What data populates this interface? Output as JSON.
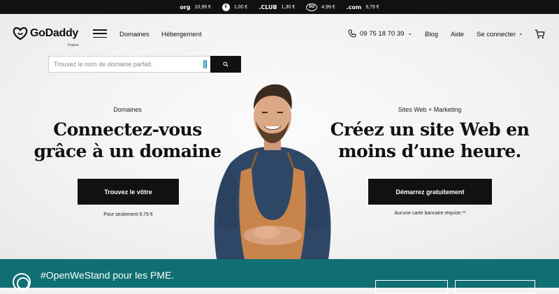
{
  "promo_bar": {
    "items": [
      {
        "tld": "org",
        "price": "10,99 €"
      },
      {
        "tld": "net",
        "price": "1,00 €"
      },
      {
        "tld": ".CLUB",
        "price": "1,30 €"
      },
      {
        "tld": "biz",
        "price": "4,99 €"
      },
      {
        "tld": ".com",
        "price": "9,79 €"
      }
    ]
  },
  "header": {
    "logo_text": "GoDaddy",
    "logo_region": "France",
    "nav": [
      "Domaines",
      "Hébergement"
    ],
    "phone": "09 75 18 70 39",
    "links": [
      "Blog",
      "Aide",
      "Se connecter"
    ]
  },
  "search": {
    "placeholder": "Trouvez le nom de domaine parfait."
  },
  "hero_left": {
    "eyebrow": "Domaines",
    "headline_line1": "Connectez-vous",
    "headline_line2": "grâce à un domaine",
    "cta": "Trouvez le vôtre",
    "note": "Pour seulement 9,79 €"
  },
  "hero_right": {
    "eyebrow": "Sites Web + Marketing",
    "headline_line1": "Créez un site Web en",
    "headline_line2": "moins d’une heure.",
    "cta": "Démarrez gratuitement",
    "note": "Aucune carte bancaire requise.**"
  },
  "band": {
    "text": "#OpenWeStand pour les PME."
  },
  "colors": {
    "band": "#0f6f73",
    "black": "#111111",
    "apron": "#c8854b",
    "shirt": "#2e4766"
  },
  "icons": [
    "org-logo",
    "net-logo",
    "club-logo",
    "biz-logo",
    "com-logo",
    "hamburger-icon",
    "phone-icon",
    "chevron-down-icon",
    "cart-icon",
    "search-icon"
  ]
}
